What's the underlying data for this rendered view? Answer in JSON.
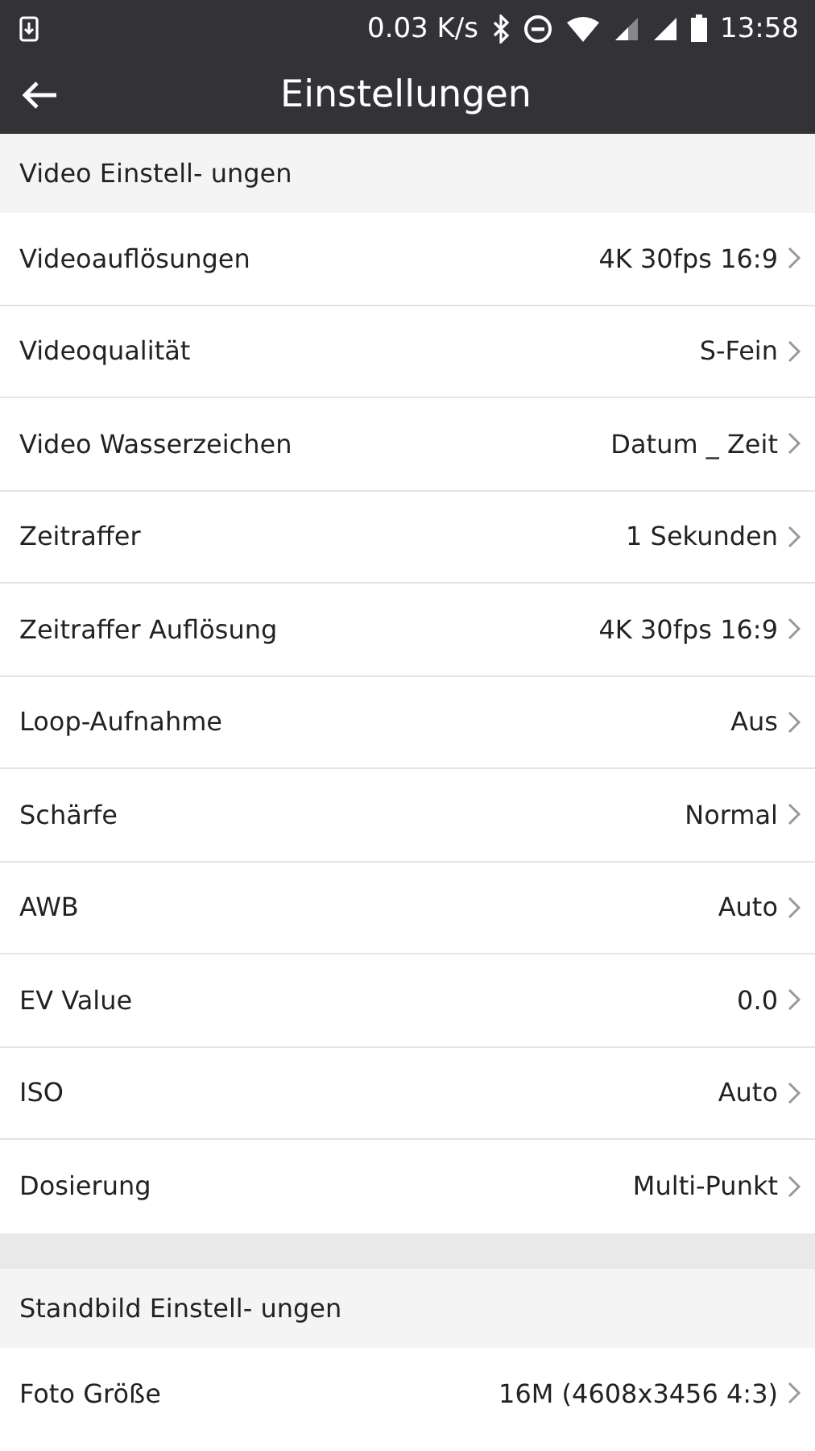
{
  "status_bar": {
    "speed": "0.03 K/s",
    "time": "13:58"
  },
  "toolbar": {
    "title": "Einstellungen"
  },
  "sections": [
    {
      "title": "Video Einstell- ungen",
      "rows": [
        {
          "label": "Videoauflösungen",
          "value": "4K 30fps 16:9"
        },
        {
          "label": "Videoqualität",
          "value": "S-Fein"
        },
        {
          "label": "Video Wasserzeichen",
          "value": "Datum _ Zeit"
        },
        {
          "label": "Zeitraffer",
          "value": "1 Sekunden"
        },
        {
          "label": "Zeitraffer Auflösung",
          "value": "4K 30fps 16:9"
        },
        {
          "label": "Loop-Aufnahme",
          "value": "Aus"
        },
        {
          "label": "Schärfe",
          "value": "Normal"
        },
        {
          "label": "AWB",
          "value": "Auto"
        },
        {
          "label": "EV Value",
          "value": "0.0"
        },
        {
          "label": "ISO",
          "value": "Auto"
        },
        {
          "label": "Dosierung",
          "value": "Multi-Punkt"
        }
      ]
    },
    {
      "title": "Standbild Einstell- ungen",
      "rows": [
        {
          "label": "Foto Größe",
          "value": "16M (4608x3456 4:3)"
        }
      ]
    }
  ]
}
